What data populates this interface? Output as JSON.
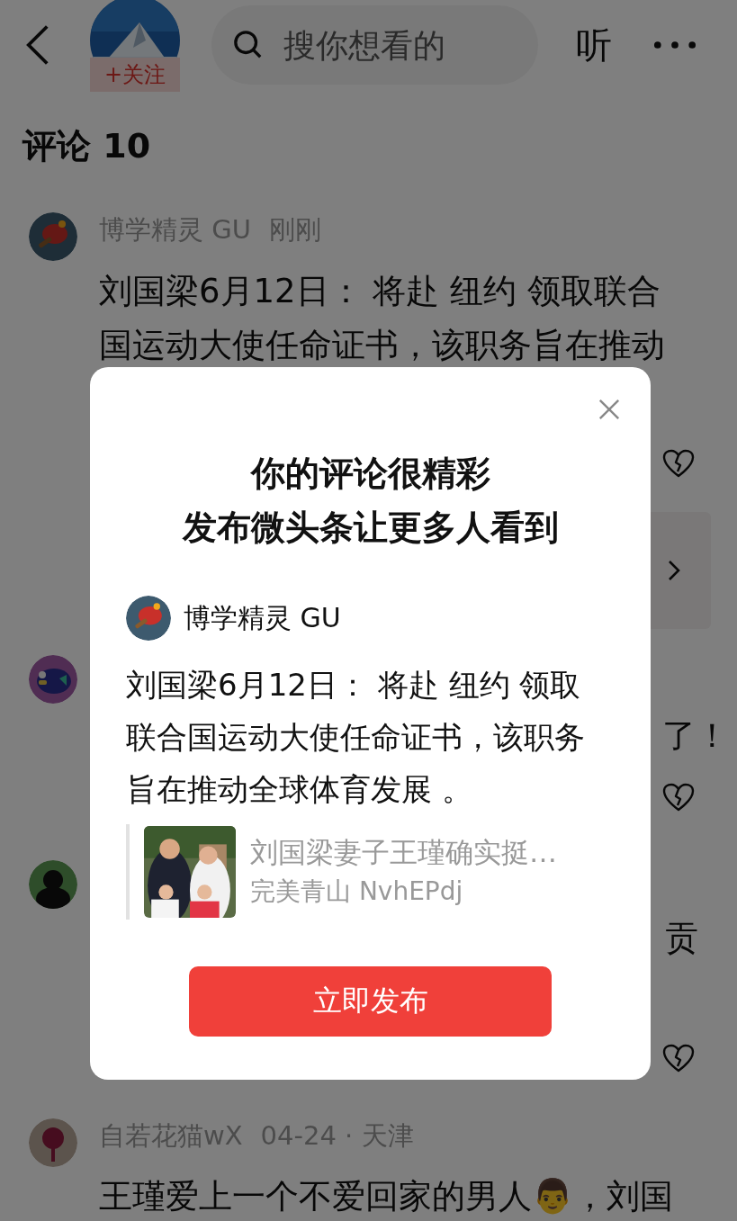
{
  "header": {
    "follow_label": "+关注",
    "search": {
      "placeholder": "搜你想看的"
    },
    "listen_label": "听"
  },
  "comments_heading": "评论 10",
  "comments": [
    {
      "kind": "full",
      "author": "博学精灵 GU",
      "meta": "刚刚",
      "lines": [
        "刘国梁6月12日： 将赴 纽约 领取联合",
        "国运动大使任命证书，该职务旨在推动"
      ],
      "link_card": true
    },
    {
      "kind": "covered",
      "fragment": "了！"
    },
    {
      "kind": "covered",
      "fragment": "贡"
    },
    {
      "kind": "bottom",
      "author": "自若花猫wX",
      "meta": "04-24 · 天津",
      "lines": [
        "王瑾爱上一个不爱回家的男人👨，刘国"
      ]
    }
  ],
  "dialog": {
    "title_lines": [
      "你的评论很精彩",
      "发布微头条让更多人看到"
    ],
    "author": "博学精灵 GU",
    "content_lines": [
      "刘国梁6月12日： 将赴 纽约 领取",
      "联合国运动大使任命证书，该职务",
      "旨在推动全球体育发展 。"
    ],
    "quote": {
      "title": "刘国梁妻子王瑾确实挺…",
      "author": "完美青山 NvhEPdj"
    },
    "button": "立即发布"
  }
}
